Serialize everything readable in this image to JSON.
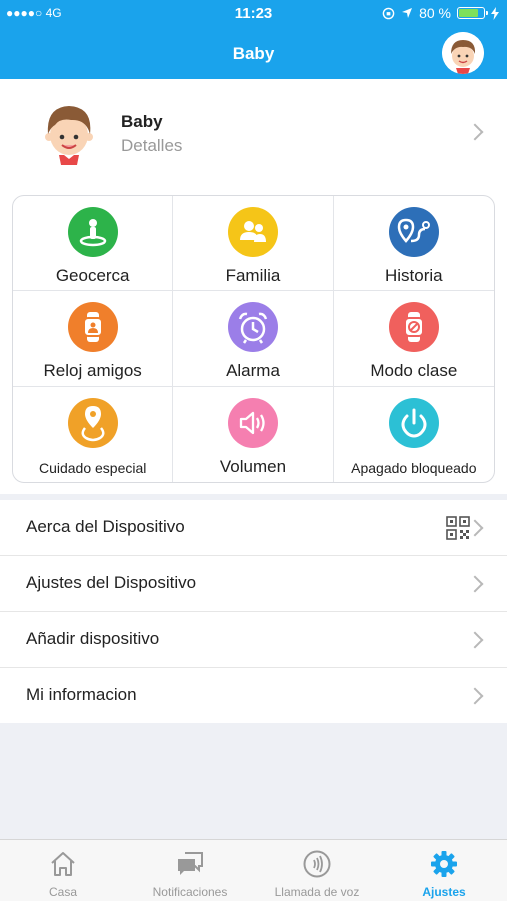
{
  "status_bar": {
    "carrier": "●●●●○ 4G",
    "time": "11:23",
    "battery_text": "80 %",
    "battery_level": 0.8
  },
  "header": {
    "title": "Baby",
    "avatar_icon": "boy-avatar-icon"
  },
  "profile": {
    "name": "Baby",
    "subtitle": "Detalles"
  },
  "grid": [
    {
      "label": "Geocerca",
      "icon": "geofence-icon",
      "color": "#2db34a"
    },
    {
      "label": "Familia",
      "icon": "family-icon",
      "color": "#f5c518"
    },
    {
      "label": "Historia",
      "icon": "history-route-icon",
      "color": "#2d6fb8"
    },
    {
      "label": "Reloj amigos",
      "icon": "watch-friends-icon",
      "color": "#f07f2b"
    },
    {
      "label": "Alarma",
      "icon": "alarm-clock-icon",
      "color": "#9b7ee8"
    },
    {
      "label": "Modo clase",
      "icon": "class-mode-icon",
      "color": "#f0605d"
    },
    {
      "label": "Cuidado especial",
      "icon": "special-care-icon",
      "color": "#f0a128"
    },
    {
      "label": "Volumen",
      "icon": "volume-icon",
      "color": "#f57fb0"
    },
    {
      "label": "Apagado bloqueado",
      "icon": "power-lock-icon",
      "color": "#2cc0d5"
    }
  ],
  "list": [
    {
      "label": "Aerca del Dispositivo",
      "icon": "qr-code-icon"
    },
    {
      "label": "Ajustes del Dispositivo"
    },
    {
      "label": "Añadir dispositivo"
    },
    {
      "label": "Mi informacion"
    }
  ],
  "tabs": [
    {
      "label": "Casa",
      "icon": "home-icon",
      "active": false
    },
    {
      "label": "Notificaciones",
      "icon": "chat-bubbles-icon",
      "active": false
    },
    {
      "label": "Llamada de voz",
      "icon": "voice-call-icon",
      "active": false
    },
    {
      "label": "Ajustes",
      "icon": "gear-icon",
      "active": true
    }
  ],
  "colors": {
    "accent": "#1aa3ec",
    "background": "#eef0f5"
  }
}
